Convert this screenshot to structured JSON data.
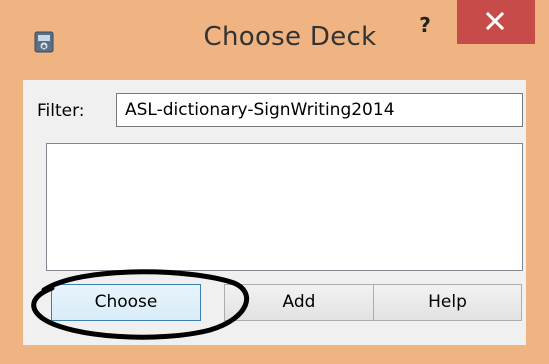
{
  "window": {
    "title": "Choose Deck",
    "help_glyph": "?",
    "close_glyph": "×",
    "icon": "anki-app-icon",
    "frame_color": "#f0b482",
    "close_color": "#c74b48"
  },
  "filter": {
    "label": "Filter:",
    "value": "ASL-dictionary-SignWriting2014"
  },
  "deck_list": {
    "items": []
  },
  "buttons": {
    "choose": "Choose",
    "add": "Add",
    "help": "Help"
  },
  "annotation": {
    "shape": "hand-drawn-ellipse",
    "color": "#000000"
  }
}
